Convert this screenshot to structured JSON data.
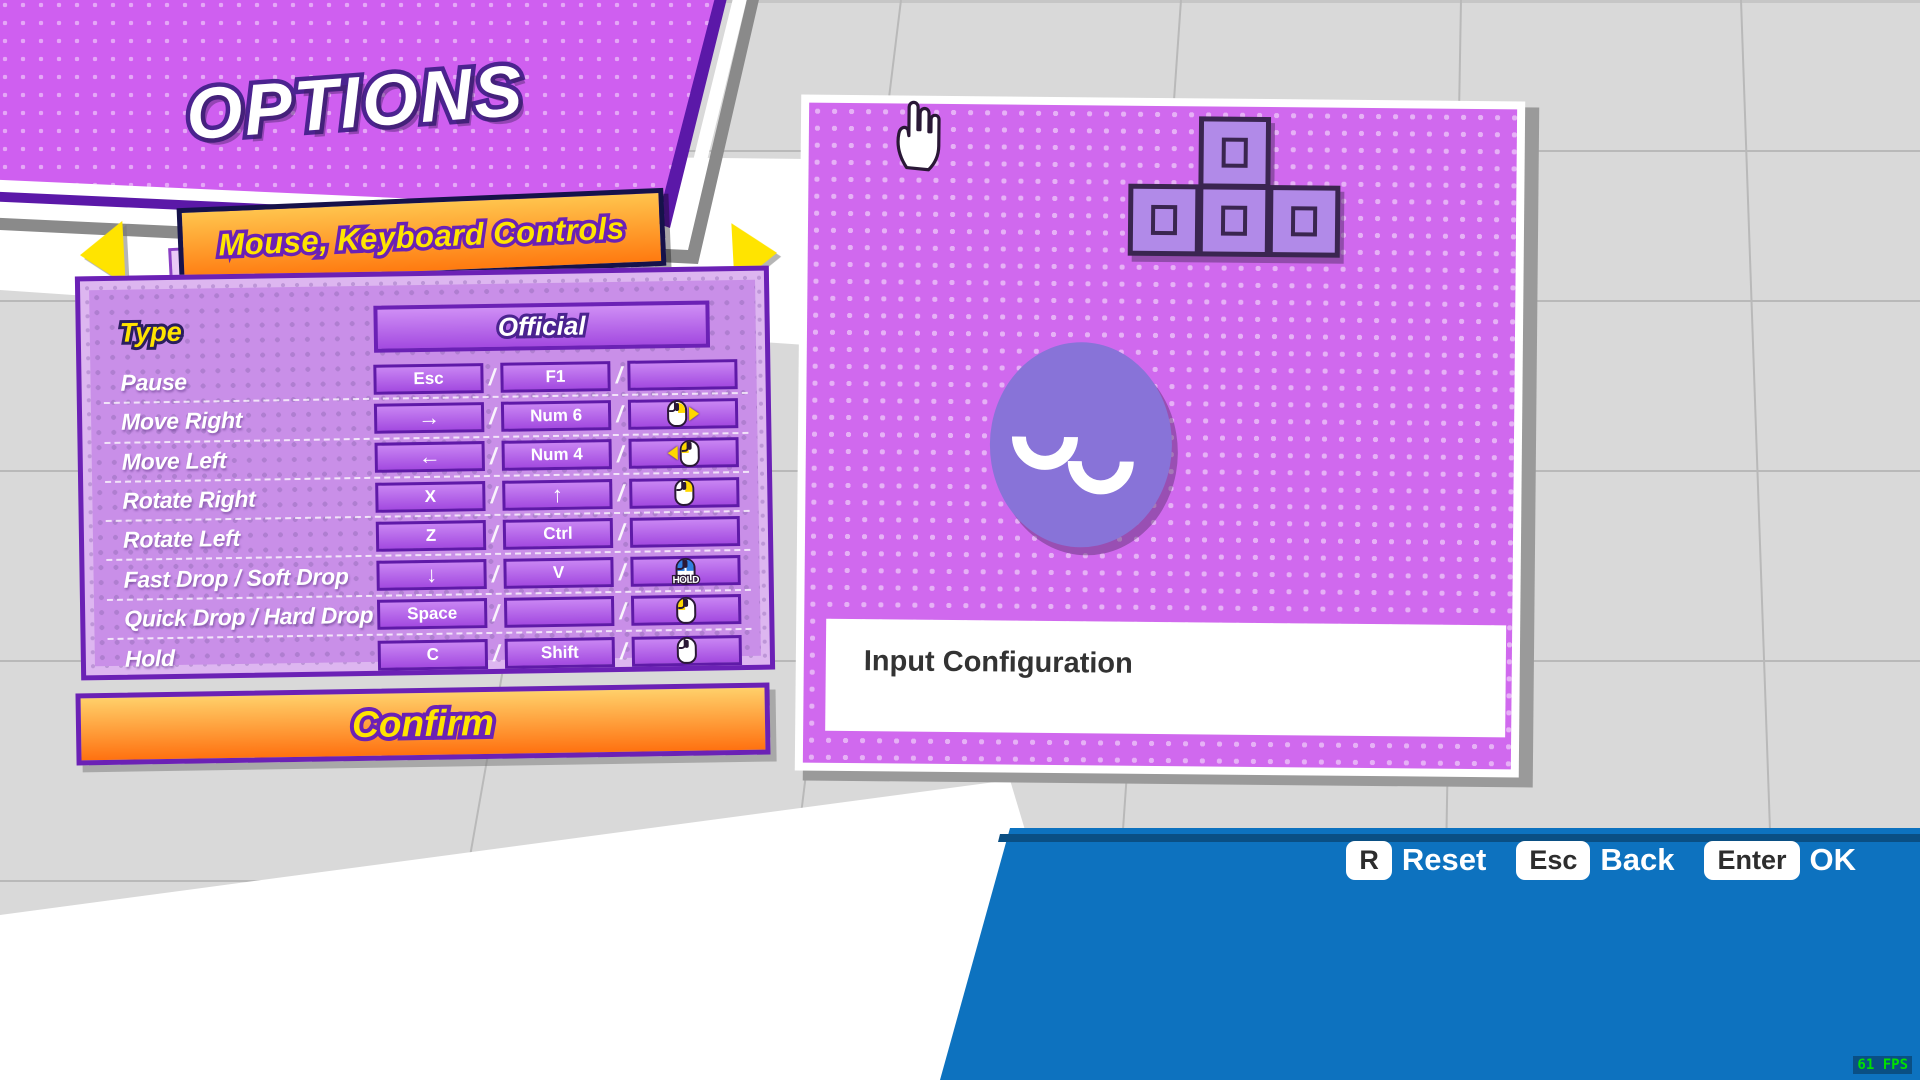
{
  "header": {
    "title": "OPTIONS"
  },
  "tab": {
    "label": "Mouse, Keyboard Controls",
    "prev_icon": "arrow-left-icon",
    "next_icon": "arrow-right-icon"
  },
  "settings": {
    "type_label": "Type",
    "type_value": "Official",
    "rows": [
      {
        "action": "Pause",
        "key1": "Esc",
        "key2": "F1",
        "mouse": "none"
      },
      {
        "action": "Move Right",
        "key1": "→",
        "key2": "Num 6",
        "mouse": "right-click-right-arrow"
      },
      {
        "action": "Move Left",
        "key1": "←",
        "key2": "Num 4",
        "mouse": "left-click-left-arrow"
      },
      {
        "action": "Rotate Right",
        "key1": "X",
        "key2": "↑",
        "mouse": "right-button"
      },
      {
        "action": "Rotate Left",
        "key1": "Z",
        "key2": "Ctrl",
        "mouse": "none"
      },
      {
        "action": "Fast Drop / Soft Drop",
        "key1": "↓",
        "key2": "V",
        "mouse": "both-buttons-hold",
        "mouse_caption": "HOLD"
      },
      {
        "action": "Quick Drop / Hard Drop",
        "key1": "Space",
        "key2": "",
        "mouse": "left-button"
      },
      {
        "action": "Hold",
        "key1": "C",
        "key2": "Shift",
        "mouse": "wheel-button"
      }
    ],
    "separator": "/"
  },
  "confirm_label": "Confirm",
  "preview": {
    "description": "Input Configuration",
    "cursor_icon": "pointing-hand-cursor",
    "tetromino_icon": "t-tetromino",
    "character_icon": "sleeping-blob-character"
  },
  "footer": {
    "hints": [
      {
        "key": "R",
        "label": "Reset"
      },
      {
        "key": "Esc",
        "label": "Back"
      },
      {
        "key": "Enter",
        "label": "OK"
      }
    ],
    "fps": "61 FPS"
  },
  "colors": {
    "magenta": "#d069ee",
    "purple": "#6b21b5",
    "yellow": "#ffe400",
    "orange": "#ff7a10",
    "blue": "#0d72bf",
    "fps_green": "#00e000"
  }
}
